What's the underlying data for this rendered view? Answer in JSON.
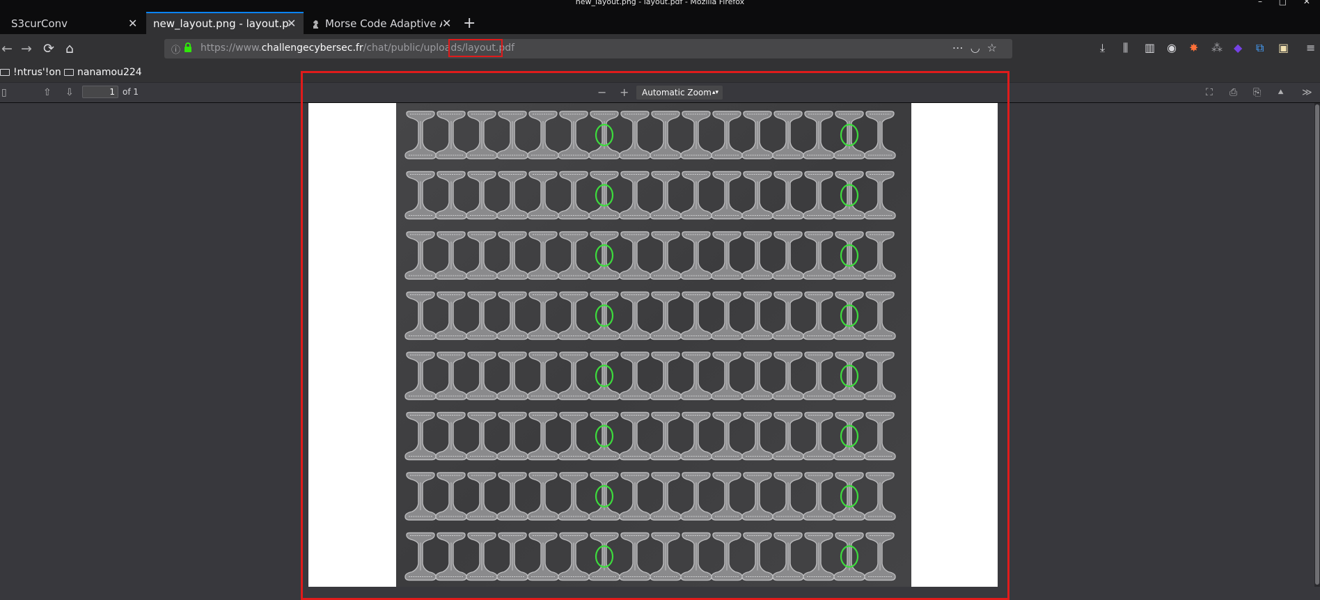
{
  "window": {
    "title": "new_layout.png - layout.pdf - Mozilla Firefox"
  },
  "tabs": [
    {
      "label": "S3curConv"
    },
    {
      "label": "new_layout.png - layout.pdf"
    },
    {
      "label": "Morse Code Adaptive Au"
    }
  ],
  "navigation": {
    "url_prefix": "https://www.",
    "url_domain": "challengecybersec.fr",
    "url_path": "/chat/public/uploads",
    "url_highlight": "/layout.pdf"
  },
  "bookmarks": [
    {
      "label": "!ntrus'!on"
    },
    {
      "label": "nanamou224"
    }
  ],
  "pdf_toolbar": {
    "page_number": "1",
    "page_count": "of 1",
    "zoom": "Automatic Zoom"
  },
  "figure": {
    "rows": 8,
    "columns": 16,
    "marked_columns": [
      6,
      14
    ],
    "marker_color": "#3ddc3d"
  },
  "colors": {
    "highlight": "#e01b1b",
    "accent": "#0a84ff"
  }
}
